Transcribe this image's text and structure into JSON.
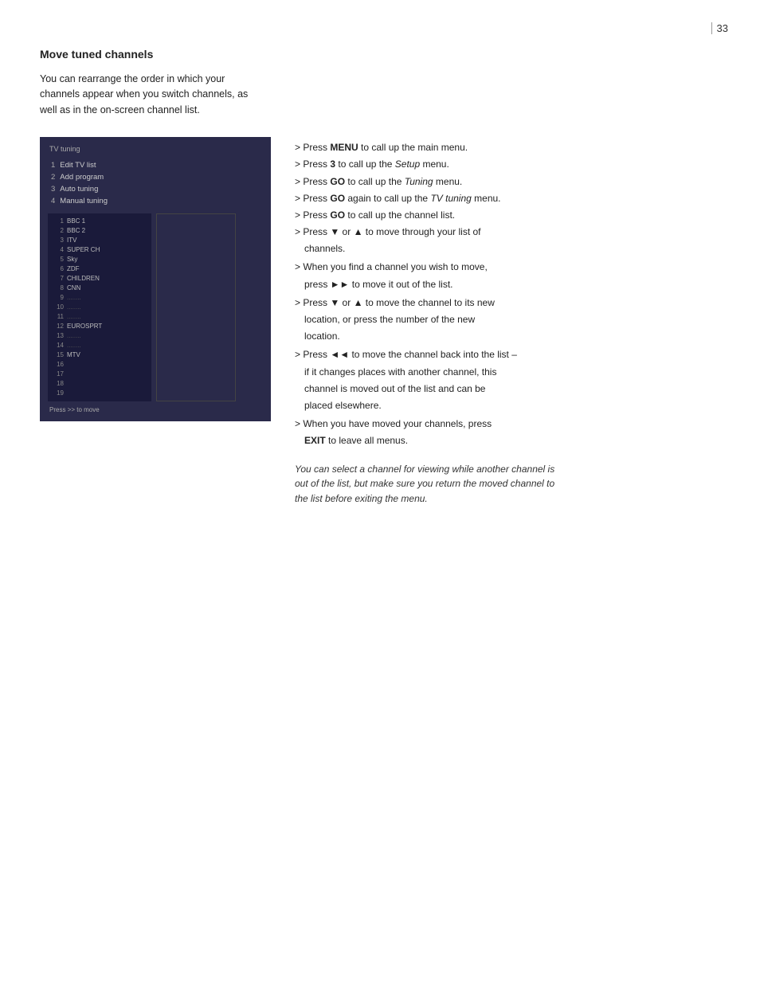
{
  "page": {
    "number": "33",
    "section_title": "Move tuned channels",
    "intro": "You can rearrange the order in which your channels appear when you switch channels, as well as in the on-screen channel list.",
    "tv_ui": {
      "title": "TV tuning",
      "menu_items": [
        {
          "num": "1",
          "label": "Edit TV list",
          "highlighted": true
        },
        {
          "num": "2",
          "label": "Add program"
        },
        {
          "num": "3",
          "label": "Auto tuning"
        },
        {
          "num": "4",
          "label": "Manual tuning"
        }
      ],
      "channels": [
        {
          "num": "1",
          "name": "BBC 1"
        },
        {
          "num": "2",
          "name": "BBC 2"
        },
        {
          "num": "3",
          "name": "ITV"
        },
        {
          "num": "4",
          "name": "SUPER CH"
        },
        {
          "num": "5",
          "name": "Sky"
        },
        {
          "num": "6",
          "name": "ZDF"
        },
        {
          "num": "7",
          "name": "CHILDREN"
        },
        {
          "num": "8",
          "name": "CNN"
        },
        {
          "num": "9",
          "name": "........"
        },
        {
          "num": "10",
          "name": "........"
        },
        {
          "num": "11",
          "name": "........"
        },
        {
          "num": "12",
          "name": "EUROSPRT"
        },
        {
          "num": "13",
          "name": "........"
        },
        {
          "num": "14",
          "name": "........"
        },
        {
          "num": "15",
          "name": "MTV"
        },
        {
          "num": "16",
          "name": ""
        },
        {
          "num": "17",
          "name": ""
        },
        {
          "num": "18",
          "name": ""
        },
        {
          "num": "19",
          "name": ""
        }
      ],
      "footer_text": "Press >> to move"
    },
    "instructions": [
      {
        "prefix": "> ",
        "text": "Press ",
        "bold": "MENU",
        "rest": " to call up the main menu."
      },
      {
        "prefix": "> ",
        "text": "Press ",
        "bold": "3",
        "rest": " to call up the ",
        "italic": "Setup",
        "end": " menu."
      },
      {
        "prefix": "> ",
        "text": "Press ",
        "bold": "GO",
        "rest": " to call up the ",
        "italic": "Tuning",
        "end": " menu."
      },
      {
        "prefix": "> ",
        "text": "Press ",
        "bold": "GO",
        "rest": " again to call up the ",
        "italic": "TV tuning",
        "end": " menu."
      },
      {
        "prefix": "> ",
        "text": "Press ",
        "bold": "GO",
        "rest": " to call up the channel list."
      },
      {
        "prefix": "> ",
        "text": "Press ▼ or ▲ to move through your list of channels."
      },
      {
        "prefix": "> ",
        "text": "When you find a channel you wish to move, press ►► to move it out of the list."
      },
      {
        "prefix": "> ",
        "text": "Press ▼ or ▲ to move the channel to its new location, or press the number of the new location."
      },
      {
        "prefix": "> ",
        "text": "Press ◄◄ to move the channel back into the list – if it changes places with another channel, this channel is moved out of the list and can be placed elsewhere."
      },
      {
        "prefix": "> ",
        "text": "When you have moved your channels, press ",
        "bold": "EXIT",
        "rest": " to leave all menus."
      }
    ],
    "note": "You can select a channel for viewing while another channel is out of the list, but make sure you return the moved channel to the list before exiting the menu."
  }
}
